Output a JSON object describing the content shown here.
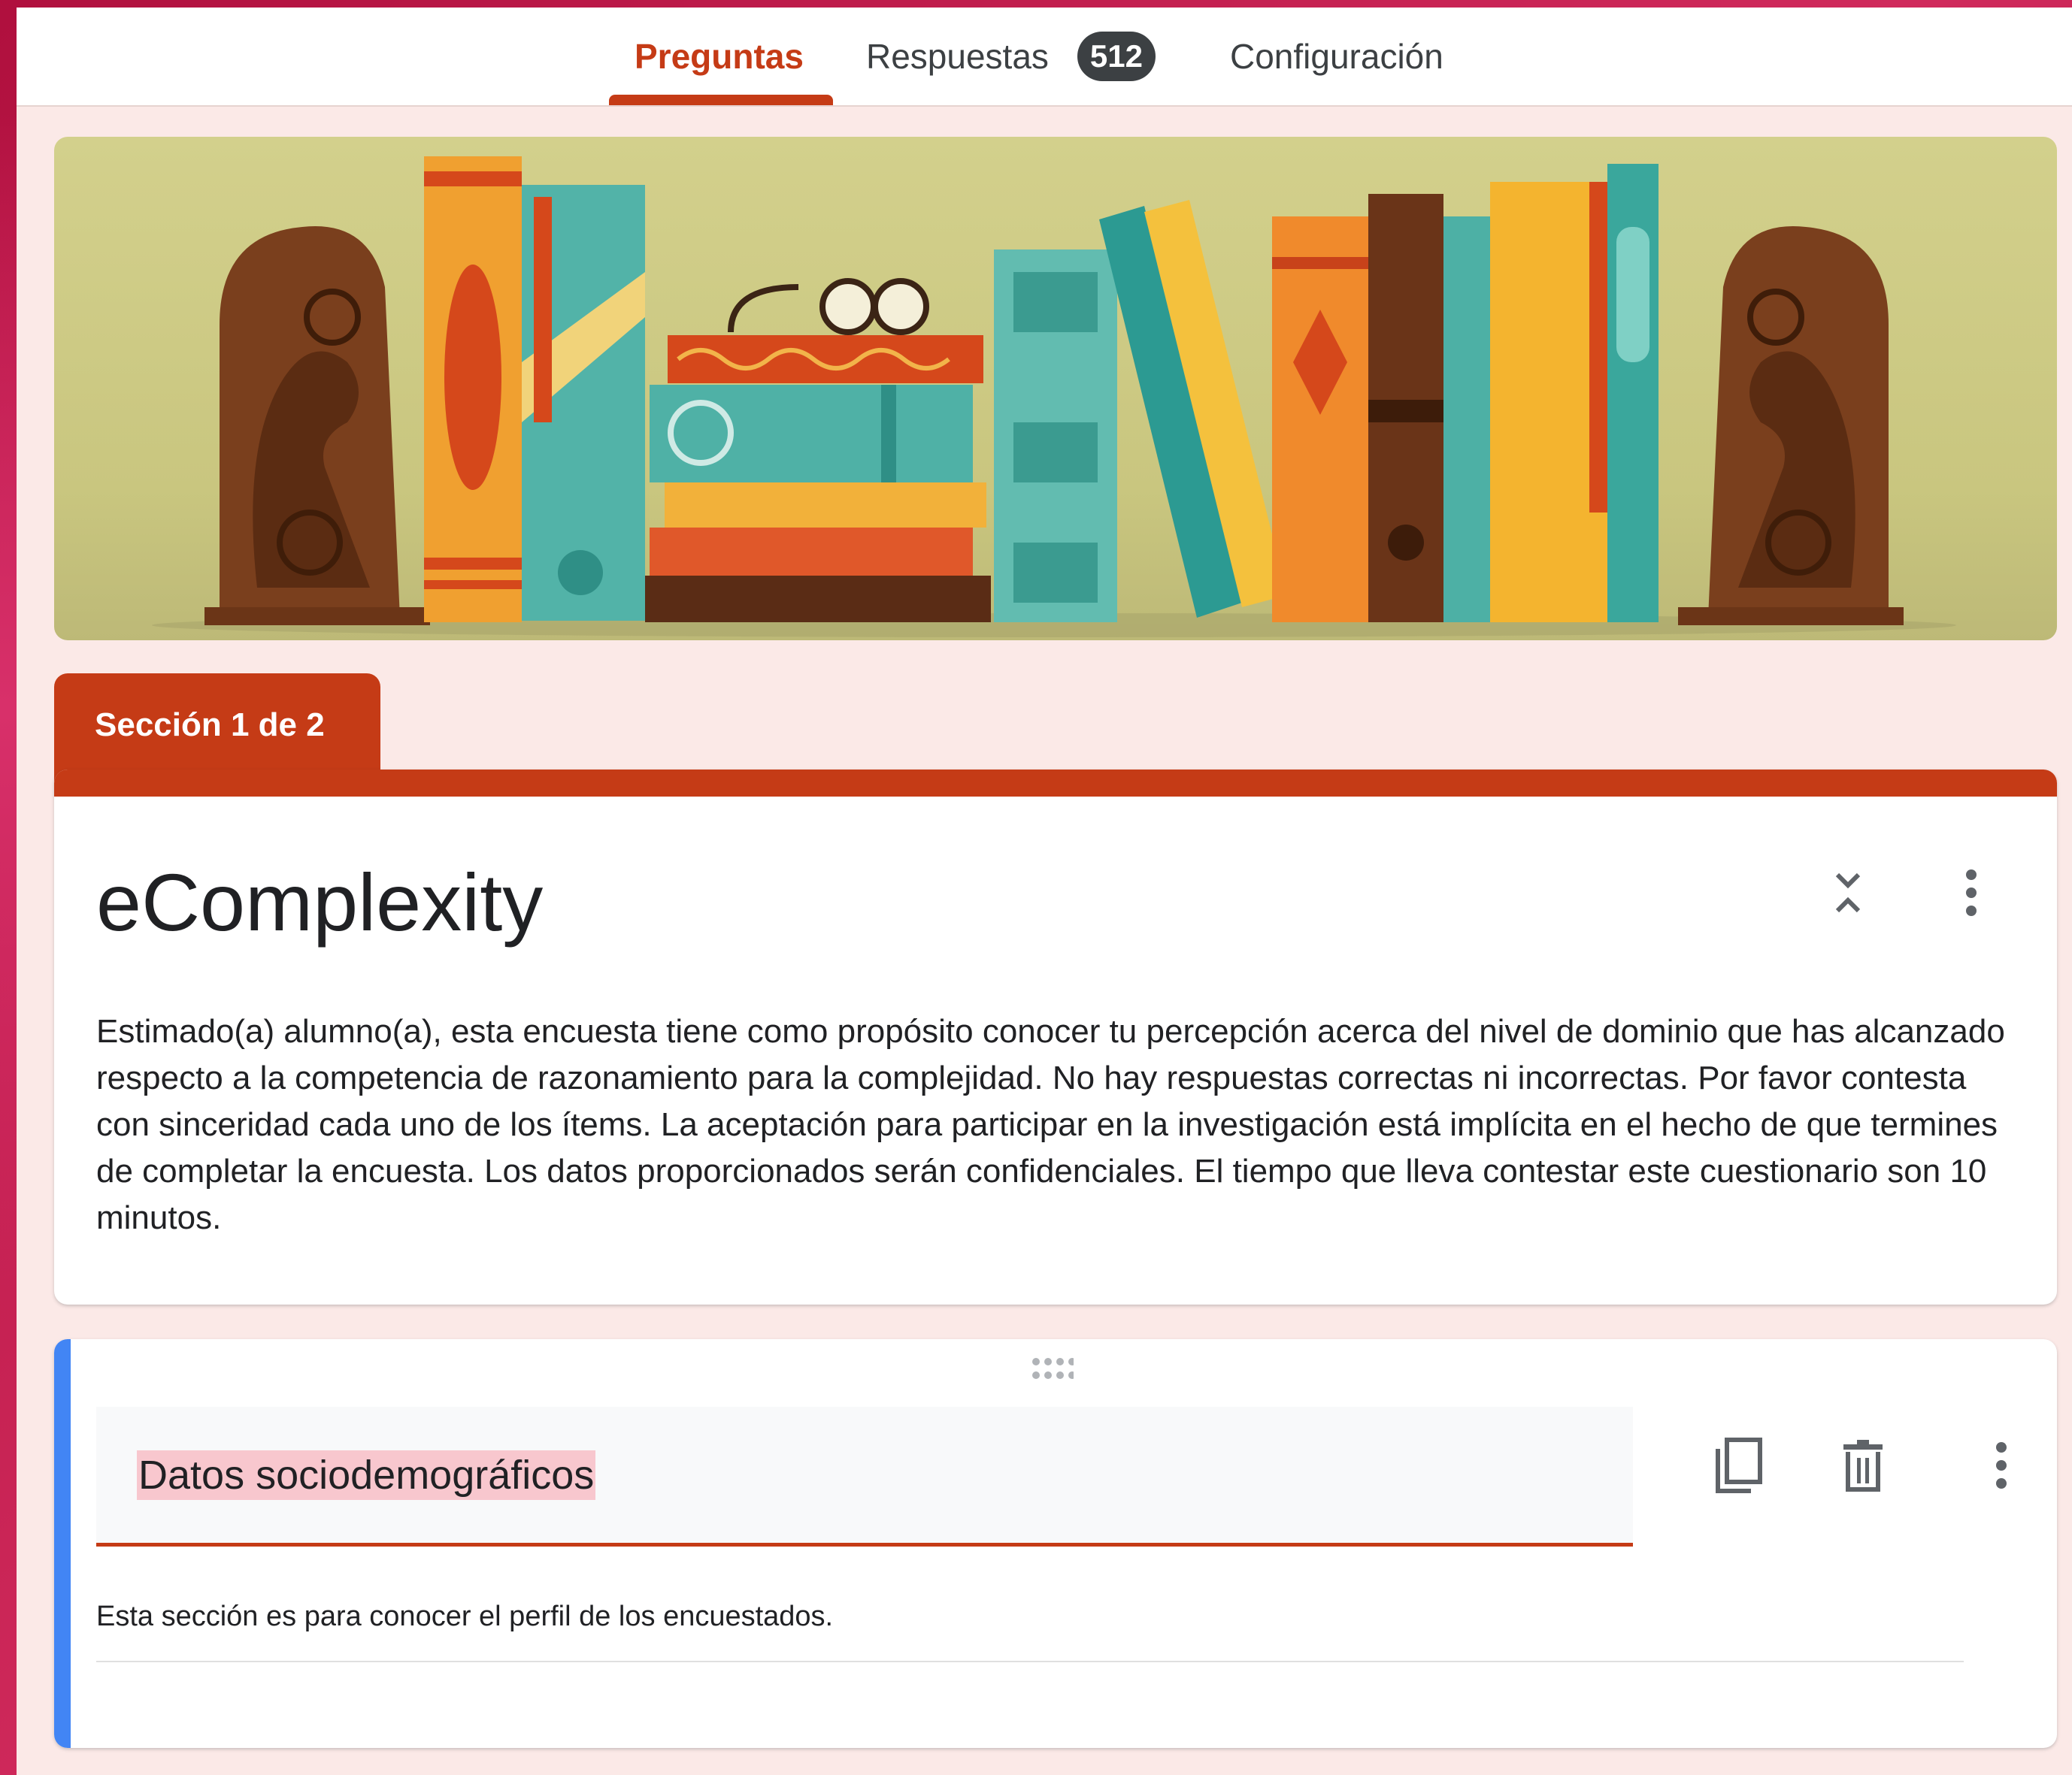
{
  "tabs": {
    "preguntas": "Preguntas",
    "respuestas": "Respuestas",
    "respuestas_count": "512",
    "configuracion": "Configuración"
  },
  "colors": {
    "theme": "#c53b16",
    "background": "#fbe9e7",
    "section_accent": "#4285f4"
  },
  "section_tab": "Sección 1 de 2",
  "form": {
    "title": "eComplexity",
    "description": "Estimado(a) alumno(a), esta encuesta tiene como propósito conocer tu percepción acerca del nivel de dominio que has alcanzado respecto a la competencia de razonamiento para la complejidad. No hay respuestas correctas ni incorrectas. Por favor contesta con sinceridad cada uno de los ítems. La aceptación para participar en la investigación está implícita en el hecho de que termines de completar la encuesta. Los datos proporcionados serán confidenciales. El tiempo que lleva contestar este cuestionario son 10 minutos."
  },
  "section": {
    "title": "Datos sociodemográficos",
    "description": "Esta sección es para conocer el perfil de los encuestados."
  },
  "icons": [
    "collapse-icon",
    "more-vert-icon",
    "drag-handle-icon",
    "duplicate-icon",
    "delete-icon"
  ]
}
